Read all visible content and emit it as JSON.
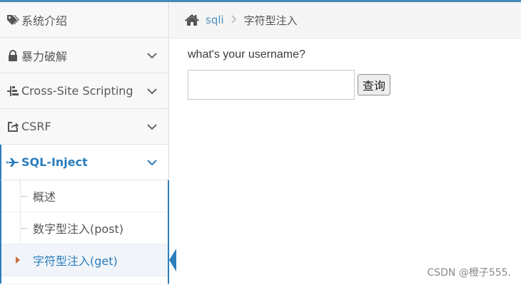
{
  "sidebar": {
    "items": [
      {
        "label": "系统介绍",
        "icon": "tags-icon",
        "chevron": false
      },
      {
        "label": "暴力破解",
        "icon": "lock-icon",
        "chevron": true
      },
      {
        "label": "Cross-Site Scripting",
        "icon": "tree-icon",
        "chevron": true
      },
      {
        "label": "CSRF",
        "icon": "share-icon",
        "chevron": true
      },
      {
        "label": "SQL-Inject",
        "icon": "plane-icon",
        "chevron": true,
        "active": true
      }
    ],
    "submenu": [
      {
        "label": "概述"
      },
      {
        "label": "数字型注入(post)"
      },
      {
        "label": "字符型注入(get)",
        "selected": true
      }
    ]
  },
  "breadcrumb": {
    "home_icon": "home-icon",
    "link": "sqli",
    "current": "字符型注入"
  },
  "form": {
    "question": "what's your username?",
    "input_value": "",
    "input_placeholder": "",
    "button_label": "查询"
  },
  "watermark": "CSDN @橙子555.",
  "colors": {
    "accent": "#2b7dbc",
    "topline": "#4a8ab8",
    "caret": "#c86c3a"
  }
}
